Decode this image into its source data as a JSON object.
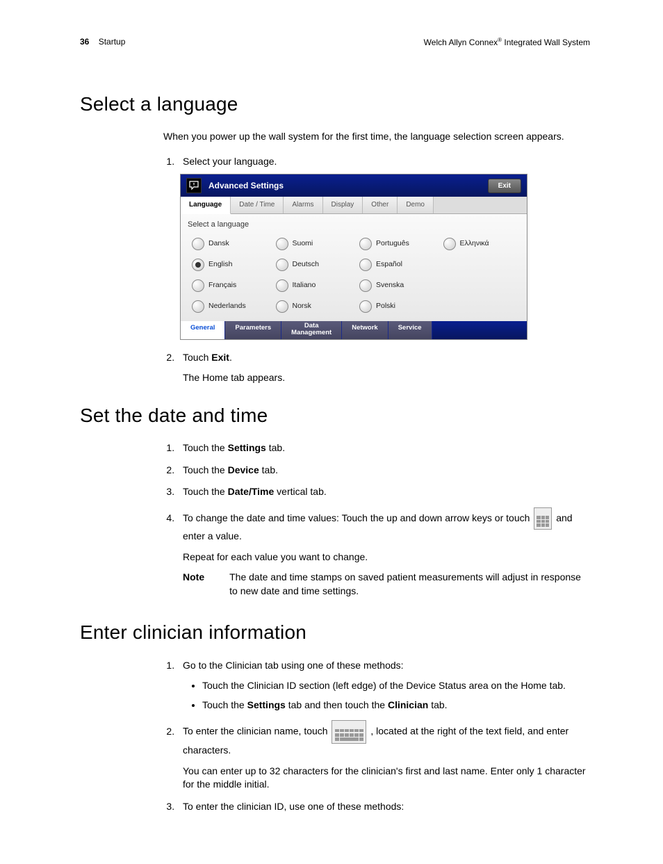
{
  "header": {
    "page_num": "36",
    "section": "Startup",
    "product_prefix": "Welch Allyn Connex",
    "product_suffix": " Integrated Wall System"
  },
  "s1": {
    "heading": "Select a language",
    "intro": "When you power up the wall system for the first time, the language selection screen appears.",
    "step1": "Select your language.",
    "step2_pre": "Touch ",
    "step2_bold": "Exit",
    "step2_post": ".",
    "step2_p": "The Home tab appears."
  },
  "device": {
    "title": "Advanced Settings",
    "exit": "Exit",
    "tabs": [
      "Language",
      "Date / Time",
      "Alarms",
      "Display",
      "Other",
      "Demo"
    ],
    "panel_title": "Select a language",
    "langs": [
      [
        "Dansk",
        false
      ],
      [
        "Suomi",
        false
      ],
      [
        "Português",
        false
      ],
      [
        "Ελληνικά",
        false
      ],
      [
        "English",
        true
      ],
      [
        "Deutsch",
        false
      ],
      [
        "Español",
        false
      ],
      [
        "",
        false
      ],
      [
        "Français",
        false
      ],
      [
        "Italiano",
        false
      ],
      [
        "Svenska",
        false
      ],
      [
        "",
        false
      ],
      [
        "Nederlands",
        false
      ],
      [
        "Norsk",
        false
      ],
      [
        "Polski",
        false
      ],
      [
        "",
        false
      ]
    ],
    "bottom_tabs": [
      "General",
      "Parameters",
      "Data Management",
      "Network",
      "Service"
    ]
  },
  "s2": {
    "heading": "Set the date and time",
    "li1_pre": "Touch the ",
    "li1_b": "Settings",
    "li1_post": " tab.",
    "li2_pre": "Touch the ",
    "li2_b": "Device",
    "li2_post": " tab.",
    "li3_pre": "Touch the ",
    "li3_b": "Date/Time",
    "li3_post": " vertical tab.",
    "li4_a": "To change the date and time values: Touch the up and down arrow keys or touch ",
    "li4_b": " and enter a value.",
    "li4_p": "Repeat for each value you want to change.",
    "note_label": "Note",
    "note_text": "The date and time stamps on saved patient measurements will adjust in response to new date and time settings."
  },
  "s3": {
    "heading": "Enter clinician information",
    "li1": "Go to the Clinician tab using one of these methods:",
    "b1": "Touch the Clinician ID section (left edge) of the Device Status area on the Home tab.",
    "b2_pre": "Touch the ",
    "b2_b1": "Settings",
    "b2_mid": " tab and then touch the ",
    "b2_b2": "Clinician",
    "b2_post": " tab.",
    "li2_a": "To enter the clinician name, touch ",
    "li2_b": ", located at the right of the text field, and enter characters.",
    "li2_p": "You can enter up to 32 characters for the clinician's first and last name. Enter only 1 character for the middle initial.",
    "li3": "To enter the clinician ID, use one of these methods:"
  }
}
